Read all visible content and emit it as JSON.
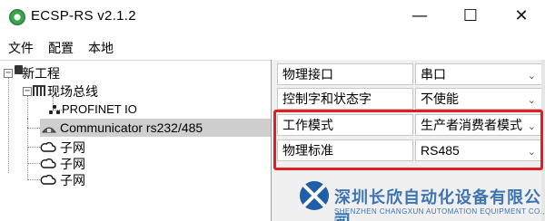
{
  "window": {
    "title": "ECSP-RS v2.1.2",
    "min_glyph": "—",
    "max_glyph": "☐",
    "close_glyph": "✕"
  },
  "menu": {
    "file": "文件",
    "config": "配置",
    "local": "本地"
  },
  "tree": {
    "expand_glyph": "−",
    "project": "新工程",
    "fieldbus": "现场总线",
    "profinet": "PROFINET IO",
    "communicator": "Communicator rs232/485",
    "subnets": [
      "子网",
      "子网",
      "子网"
    ]
  },
  "properties": [
    {
      "label": "物理接口",
      "value": "串口"
    },
    {
      "label": "控制字和状态字",
      "value": "不使能"
    },
    {
      "label": "工作模式",
      "value": "生产者消费者模式"
    },
    {
      "label": "物理标准",
      "value": "RS485"
    }
  ],
  "chevron_glyph": "⌄",
  "watermark": {
    "cn": "深圳长欣自动化设备有限公司",
    "en": "SHENZHEN CHANGXUN AUTOMATION EQUIPMENT CO., LTD."
  },
  "colors": {
    "highlight": "#e02020",
    "selected_row": "#cfcfcf",
    "watermark": "#1f5fa8"
  }
}
